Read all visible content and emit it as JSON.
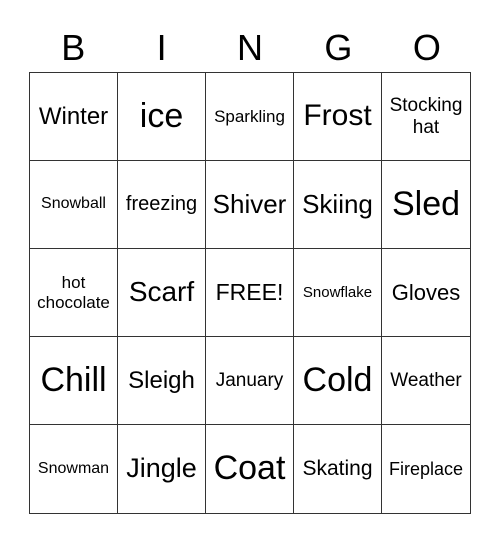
{
  "header": [
    "B",
    "I",
    "N",
    "G",
    "O"
  ],
  "cells": [
    "Winter",
    "ice",
    "Sparkling",
    "Frost",
    "Stocking hat",
    "Snowball",
    "freezing",
    "Shiver",
    "Skiing",
    "Sled",
    "hot chocolate",
    "Scarf",
    "FREE!",
    "Snowflake",
    "Gloves",
    "Chill",
    "Sleigh",
    "January",
    "Cold",
    "Weather",
    "Snowman",
    "Jingle",
    "Coat",
    "Skating",
    "Fireplace"
  ]
}
